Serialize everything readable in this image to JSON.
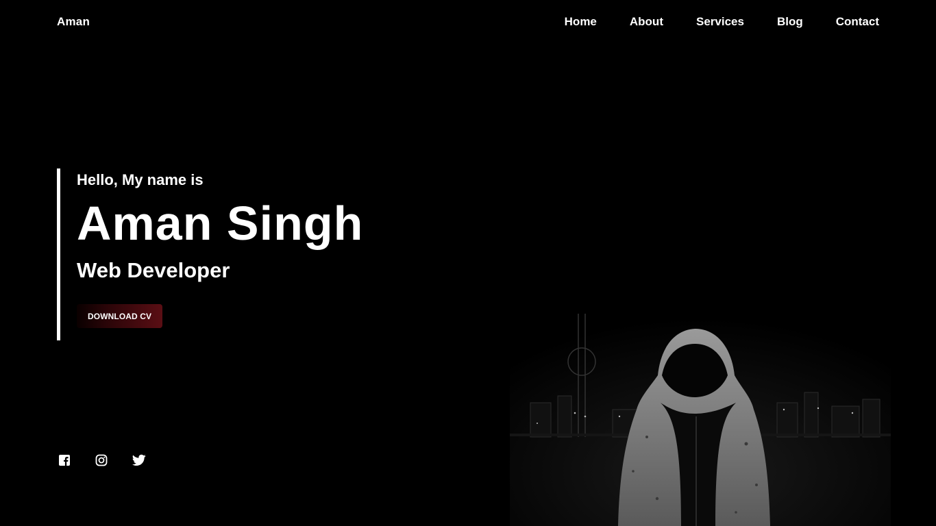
{
  "brand": "Aman",
  "nav": {
    "items": [
      "Home",
      "About",
      "Services",
      "Blog",
      "Contact"
    ]
  },
  "hero": {
    "greeting": "Hello, My name is",
    "name": "Aman Singh",
    "role": "Web Developer",
    "cta_label": "DOWNLOAD CV"
  },
  "social": {
    "icons": [
      "facebook-icon",
      "instagram-icon",
      "twitter-icon"
    ]
  },
  "colors": {
    "background": "#000000",
    "text": "#ffffff",
    "accent": "#5a0e14"
  }
}
